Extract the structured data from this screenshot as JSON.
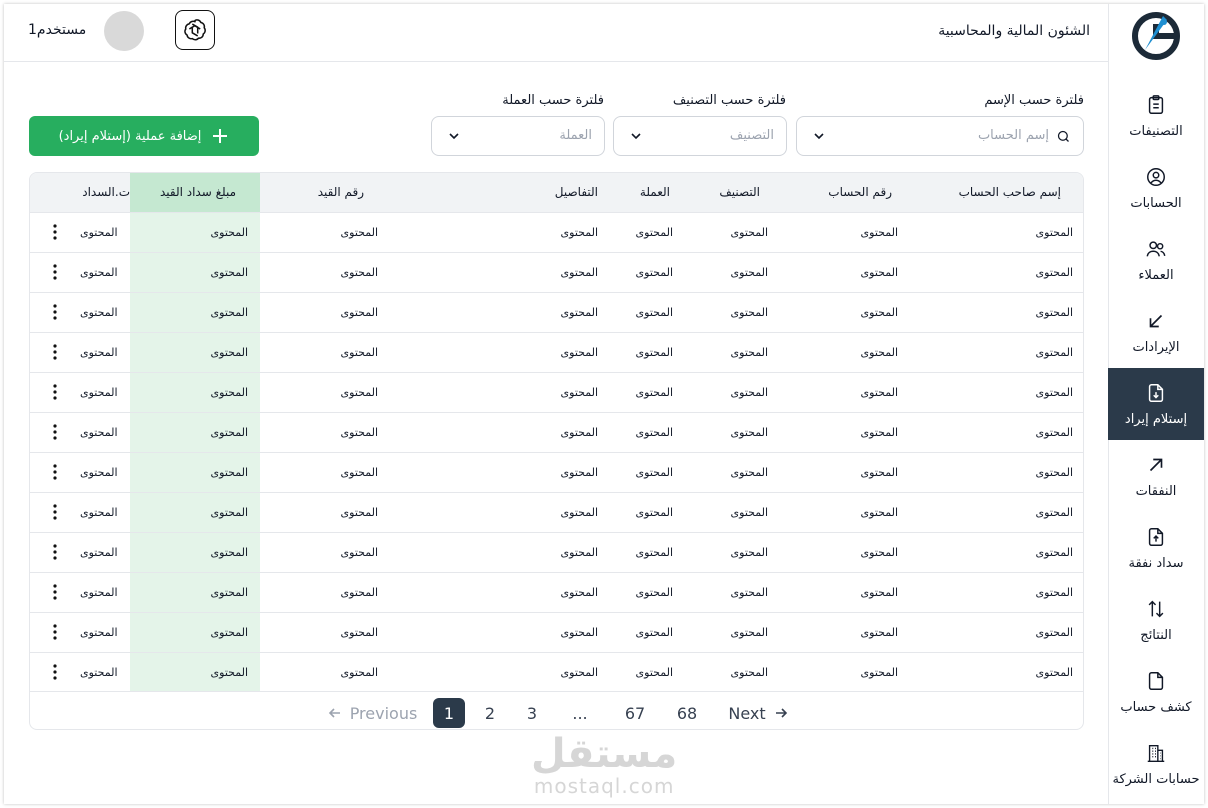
{
  "header": {
    "title": "الشئون المالية والمحاسبية",
    "user_name": "مستخدم1"
  },
  "sidebar": {
    "items": [
      {
        "label": "التصنيفات",
        "icon": "clipboard-icon",
        "active": false
      },
      {
        "label": "الحسابات",
        "icon": "user-circle-icon",
        "active": false
      },
      {
        "label": "العملاء",
        "icon": "users-icon",
        "active": false
      },
      {
        "label": "الإيرادات",
        "icon": "arrow-down-left-icon",
        "active": false
      },
      {
        "label": "إستلام إيراد",
        "icon": "file-download-icon",
        "active": true
      },
      {
        "label": "النفقات",
        "icon": "arrow-up-right-icon",
        "active": false
      },
      {
        "label": "سداد نفقة",
        "icon": "file-upload-icon",
        "active": false
      },
      {
        "label": "النتائج",
        "icon": "arrows-up-down-icon",
        "active": false
      },
      {
        "label": "كشف حساب",
        "icon": "file-icon",
        "active": false
      },
      {
        "label": "حسابات الشركة",
        "icon": "building-icon",
        "active": false
      }
    ]
  },
  "filters": {
    "name": {
      "label": "فلترة حسب الإسم",
      "placeholder": "إسم الحساب"
    },
    "category": {
      "label": "فلترة حسب التصنيف",
      "placeholder": "التصنيف"
    },
    "currency": {
      "label": "فلترة حسب العملة",
      "placeholder": "العملة"
    }
  },
  "add_button": {
    "label": "إضافة عملية (إستلام إيراد)"
  },
  "table": {
    "columns": [
      "إسم صاحب الحساب",
      "رقم الحساب",
      "التصنيف",
      "العملة",
      "التفاصيل",
      "رقم القيد",
      "مبلغ سداد القيد",
      "ت.السداد"
    ],
    "rows": [
      [
        "المحتوى",
        "المحتوى",
        "المحتوى",
        "المحتوى",
        "المحتوى",
        "المحتوى",
        "المحتوى",
        "المحتوى"
      ],
      [
        "المحتوى",
        "المحتوى",
        "المحتوى",
        "المحتوى",
        "المحتوى",
        "المحتوى",
        "المحتوى",
        "المحتوى"
      ],
      [
        "المحتوى",
        "المحتوى",
        "المحتوى",
        "المحتوى",
        "المحتوى",
        "المحتوى",
        "المحتوى",
        "المحتوى"
      ],
      [
        "المحتوى",
        "المحتوى",
        "المحتوى",
        "المحتوى",
        "المحتوى",
        "المحتوى",
        "المحتوى",
        "المحتوى"
      ],
      [
        "المحتوى",
        "المحتوى",
        "المحتوى",
        "المحتوى",
        "المحتوى",
        "المحتوى",
        "المحتوى",
        "المحتوى"
      ],
      [
        "المحتوى",
        "المحتوى",
        "المحتوى",
        "المحتوى",
        "المحتوى",
        "المحتوى",
        "المحتوى",
        "المحتوى"
      ],
      [
        "المحتوى",
        "المحتوى",
        "المحتوى",
        "المحتوى",
        "المحتوى",
        "المحتوى",
        "المحتوى",
        "المحتوى"
      ],
      [
        "المحتوى",
        "المحتوى",
        "المحتوى",
        "المحتوى",
        "المحتوى",
        "المحتوى",
        "المحتوى",
        "المحتوى"
      ],
      [
        "المحتوى",
        "المحتوى",
        "المحتوى",
        "المحتوى",
        "المحتوى",
        "المحتوى",
        "المحتوى",
        "المحتوى"
      ],
      [
        "المحتوى",
        "المحتوى",
        "المحتوى",
        "المحتوى",
        "المحتوى",
        "المحتوى",
        "المحتوى",
        "المحتوى"
      ],
      [
        "المحتوى",
        "المحتوى",
        "المحتوى",
        "المحتوى",
        "المحتوى",
        "المحتوى",
        "المحتوى",
        "المحتوى"
      ],
      [
        "المحتوى",
        "المحتوى",
        "المحتوى",
        "المحتوى",
        "المحتوى",
        "المحتوى",
        "المحتوى",
        "المحتوى"
      ]
    ]
  },
  "pagination": {
    "prev_label": "Previous",
    "next_label": "Next",
    "pages": [
      "1",
      "2",
      "3",
      "...",
      "67",
      "68"
    ],
    "current": "1"
  },
  "watermark": {
    "arabic": "مستقل",
    "latin": "mostaql.com"
  },
  "colors": {
    "accent": "#27ae5f",
    "active_nav": "#2b3a4a",
    "highlight_column": "#e4f4e9"
  }
}
